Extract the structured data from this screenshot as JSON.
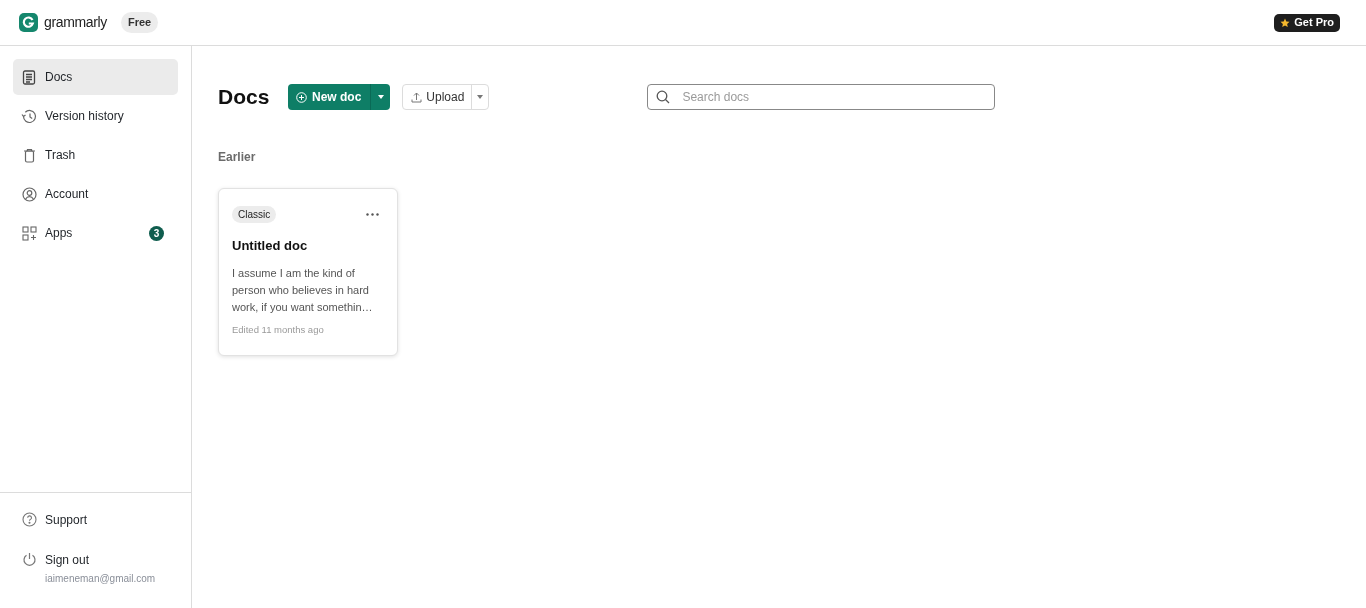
{
  "header": {
    "logo_text": "grammarly",
    "plan_badge": "Free",
    "get_pro_button": "Get Pro"
  },
  "sidebar": {
    "items": [
      {
        "label": "Docs",
        "selected": true
      },
      {
        "label": "Version history",
        "selected": false
      },
      {
        "label": "Trash",
        "selected": false
      },
      {
        "label": "Account",
        "selected": false
      },
      {
        "label": "Apps",
        "selected": false,
        "badge": "3"
      }
    ],
    "footer_items": [
      {
        "label": "Support"
      },
      {
        "label": "Sign out",
        "sublabel": "iaimeneman@gmail.com"
      }
    ]
  },
  "main": {
    "title": "Docs",
    "new_doc_button": "New doc",
    "upload_button": "Upload",
    "search": {
      "placeholder": "Search docs"
    },
    "section_heading": "Earlier",
    "docs": [
      {
        "tag": "Classic",
        "title": "Untitled doc",
        "excerpt": "I assume I am the kind of person who believes in hard work, if you want somethin…",
        "edited": "Edited 11 months ago"
      }
    ]
  }
}
